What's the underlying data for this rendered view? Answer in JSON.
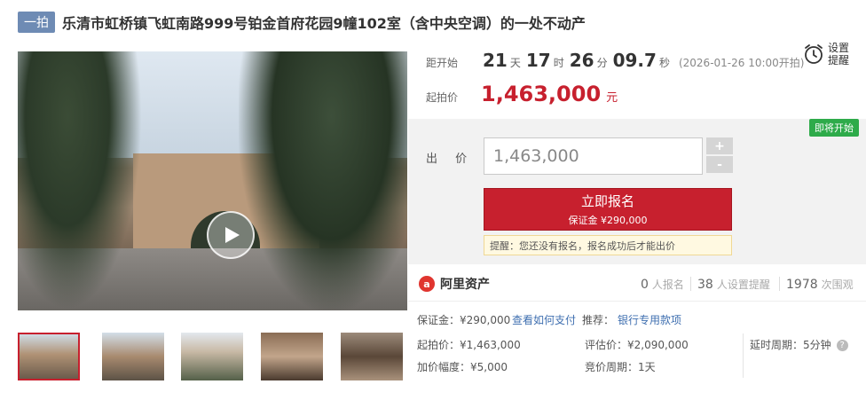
{
  "header": {
    "badge": "一拍",
    "title": "乐清市虹桥镇飞虹南路999号铂金首府花园9幢102室（含中央空调）的一处不动产"
  },
  "countdown": {
    "label": "距开始",
    "days": "21",
    "days_unit": "天",
    "hours": "17",
    "hours_unit": "时",
    "minutes": "26",
    "minutes_unit": "分",
    "seconds": "09.7",
    "seconds_unit": "秒",
    "start_note": "(2026-01-26 10:00开拍)"
  },
  "starting_price": {
    "label": "起拍价",
    "value": "1,463,000",
    "unit": "元"
  },
  "settings": {
    "label": "设置提醒",
    "icon": "alarm-clock-icon"
  },
  "bid": {
    "status_tag": "即将开始",
    "label": "出 价",
    "input_value": "1,463,000",
    "plus": "+",
    "minus": "-",
    "signup_label": "立即报名",
    "deposit_label": "保证金 ¥290,000",
    "notice": "提醒：您还没有报名，报名成功后才能出价"
  },
  "stats": {
    "logo_text": "阿里资产",
    "signups_count": "0",
    "signups_label": "人报名",
    "reminders_count": "38",
    "reminders_label": "人设置提醒",
    "views_count": "1978",
    "views_label": "次围观"
  },
  "details": {
    "deposit": "保证金：¥290,000",
    "how_to_pay": "查看如何支付",
    "recommend_label": "推荐：",
    "recommend_link": "银行专用款项",
    "start_price": "起拍价：¥1,463,000",
    "appraisal": "评估价：¥2,090,000",
    "delay": "延时周期：5分钟",
    "increment": "加价幅度：¥5,000",
    "auction_period": "竞价周期：1天"
  },
  "colors": {
    "accent_red": "#c7202e",
    "badge_blue": "#6e8bb4",
    "status_green": "#2eab4a",
    "link_blue": "#3f6fb0"
  }
}
